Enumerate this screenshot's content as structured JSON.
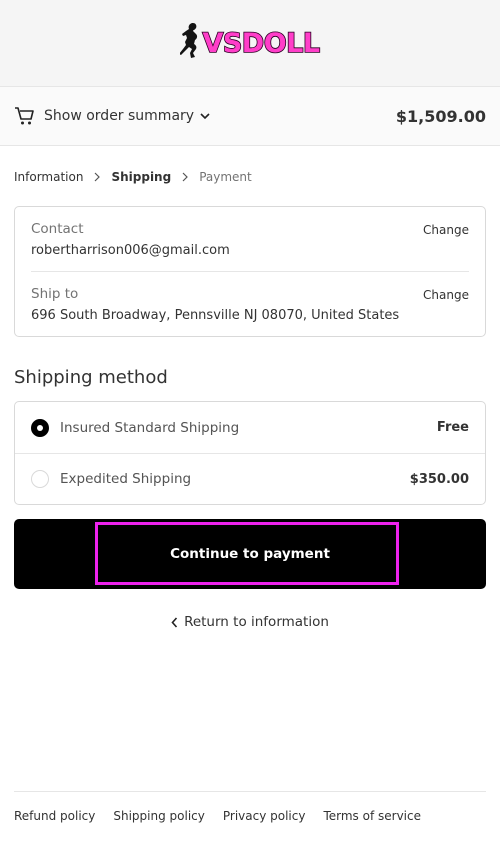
{
  "brand": {
    "logo_text": "VSDOLL",
    "logo_color": "#ff3ec9"
  },
  "order_summary": {
    "toggle_label": "Show order summary",
    "total": "$1,509.00"
  },
  "breadcrumb": {
    "items": [
      {
        "label": "Information",
        "state": "link"
      },
      {
        "label": "Shipping",
        "state": "current"
      },
      {
        "label": "Payment",
        "state": "upcoming"
      }
    ]
  },
  "review": {
    "contact": {
      "label": "Contact",
      "value": "robertharrison006@gmail.com",
      "change_label": "Change"
    },
    "ship_to": {
      "label": "Ship to",
      "value": "696 South Broadway, Pennsville NJ 08070, United States",
      "change_label": "Change"
    }
  },
  "shipping_method": {
    "title": "Shipping method",
    "options": [
      {
        "name": "Insured Standard Shipping",
        "price": "Free",
        "selected": true
      },
      {
        "name": "Expedited Shipping",
        "price": "$350.00",
        "selected": false
      }
    ]
  },
  "actions": {
    "continue_label": "Continue to payment",
    "return_label": "Return to information"
  },
  "footer": {
    "links": [
      "Refund policy",
      "Shipping policy",
      "Privacy policy",
      "Terms of service"
    ]
  },
  "colors": {
    "button_bg": "#000000",
    "highlight": "#ee22ee"
  }
}
